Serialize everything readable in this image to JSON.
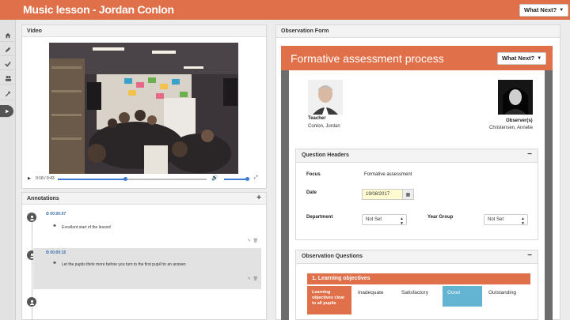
{
  "app": {
    "title": "Music lesson - Jordan Conlon",
    "whats_next": "What Next?"
  },
  "rail": {
    "icons": [
      "home-icon",
      "pencil-icon",
      "check-icon",
      "users-icon",
      "wrench-icon",
      "play-icon"
    ]
  },
  "video": {
    "panel_title": "Video",
    "time": "0:18 / 0:43",
    "progress": 0.45,
    "volume": 1.0
  },
  "annotations": {
    "panel_title": "Annotations",
    "add_label": "+",
    "items": [
      {
        "time": "00:00:07",
        "text": "Excellent start of the lesson!"
      },
      {
        "time": "00:00:15",
        "text": "Let the pupils think more before you turn to the first pupil for an answer."
      }
    ]
  },
  "form": {
    "panel_title": "Observation Form",
    "title": "Formative assessment process",
    "whats_next": "What Next?",
    "teacher": {
      "role": "Teacher",
      "name": "Conlon, Jordan"
    },
    "observer": {
      "role": "Observer(s)",
      "name": "Christensen, Annelie"
    },
    "question_headers": {
      "title": "Question Headers",
      "focus_label": "Focus",
      "focus_value": "Formative assessment",
      "date_label": "Date",
      "date_value": "19/08/2017",
      "department_label": "Department",
      "department_value": "Not Set",
      "year_group_label": "Year Group",
      "year_group_value": "Not Set"
    },
    "observation_questions": {
      "title": "Observation Questions",
      "section": "1. Learning objectives",
      "criterion": "Learning objectives clear to all pupils",
      "ratings": [
        "Inadequate",
        "Satisfactory",
        "Good",
        "Outstanding"
      ],
      "selected": "Good"
    }
  },
  "colors": {
    "brand": "#e0704a",
    "selected": "#63b3d2",
    "link": "#3d6fb0"
  }
}
